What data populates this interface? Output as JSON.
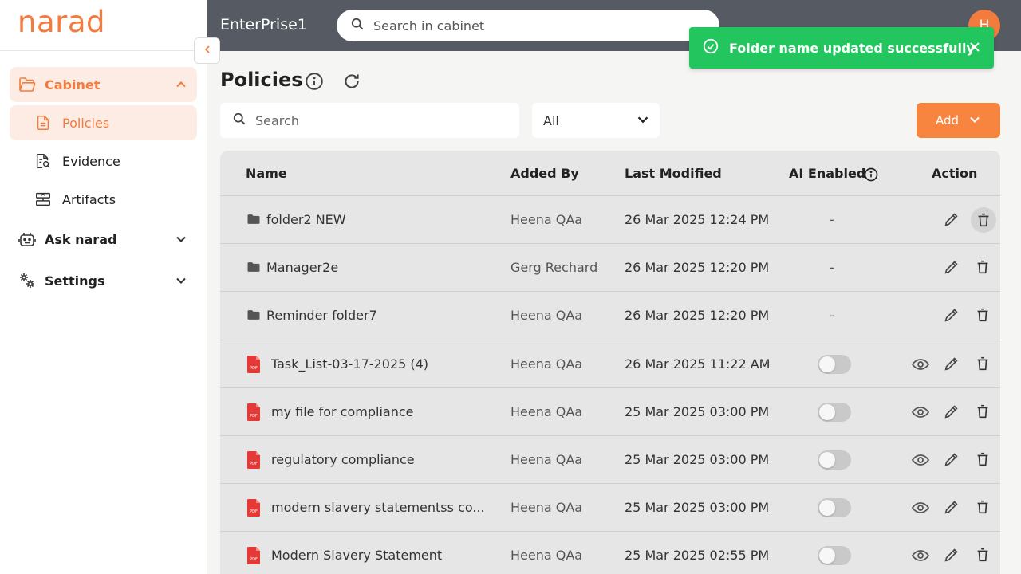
{
  "app": {
    "logo": "narad",
    "org": "EnterPrise1",
    "avatar_initial": "H",
    "accent": "#f47b3e"
  },
  "topbar": {
    "search_placeholder": "Search in cabinet"
  },
  "toast": {
    "message": "Folder name updated successfully",
    "color": "#22c55e"
  },
  "sidebar": {
    "cabinet": "Cabinet",
    "items": [
      {
        "label": "Policies",
        "icon": "document-icon"
      },
      {
        "label": "Evidence",
        "icon": "evidence-icon"
      },
      {
        "label": "Artifacts",
        "icon": "artifacts-icon"
      }
    ],
    "ask": "Ask narad",
    "settings": "Settings"
  },
  "page": {
    "title": "Policies"
  },
  "filters": {
    "search_placeholder": "Search",
    "select_value": "All",
    "add_label": "Add"
  },
  "table": {
    "headers": {
      "name": "Name",
      "added_by": "Added By",
      "last_modified": "Last Modified",
      "ai_enabled": "AI Enabled",
      "action": "Action"
    },
    "rows": [
      {
        "type": "folder",
        "name": "folder2 NEW",
        "added_by": "Heena QAa",
        "modified": "26 Mar 2025 12:24 PM",
        "ai": "-"
      },
      {
        "type": "folder",
        "name": "Manager2e",
        "added_by": "Gerg Rechard",
        "modified": "26 Mar 2025 12:20 PM",
        "ai": "-"
      },
      {
        "type": "folder",
        "name": "Reminder folder7",
        "added_by": "Heena QAa",
        "modified": "26 Mar 2025 12:20 PM",
        "ai": "-"
      },
      {
        "type": "pdf",
        "name": "Task_List-03-17-2025 (4)",
        "added_by": "Heena QAa",
        "modified": "26 Mar 2025 11:22 AM",
        "ai": "off"
      },
      {
        "type": "pdf",
        "name": "my file for compliance",
        "added_by": "Heena QAa",
        "modified": "25 Mar 2025 03:00 PM",
        "ai": "off"
      },
      {
        "type": "pdf",
        "name": "regulatory compliance",
        "added_by": "Heena QAa",
        "modified": "25 Mar 2025 03:00 PM",
        "ai": "off"
      },
      {
        "type": "pdf",
        "name": "modern slavery statementss co...",
        "added_by": "Heena QAa",
        "modified": "25 Mar 2025 03:00 PM",
        "ai": "off"
      },
      {
        "type": "pdf",
        "name": "Modern Slavery Statement",
        "added_by": "Heena QAa",
        "modified": "25 Mar 2025 02:55 PM",
        "ai": "off"
      }
    ]
  }
}
